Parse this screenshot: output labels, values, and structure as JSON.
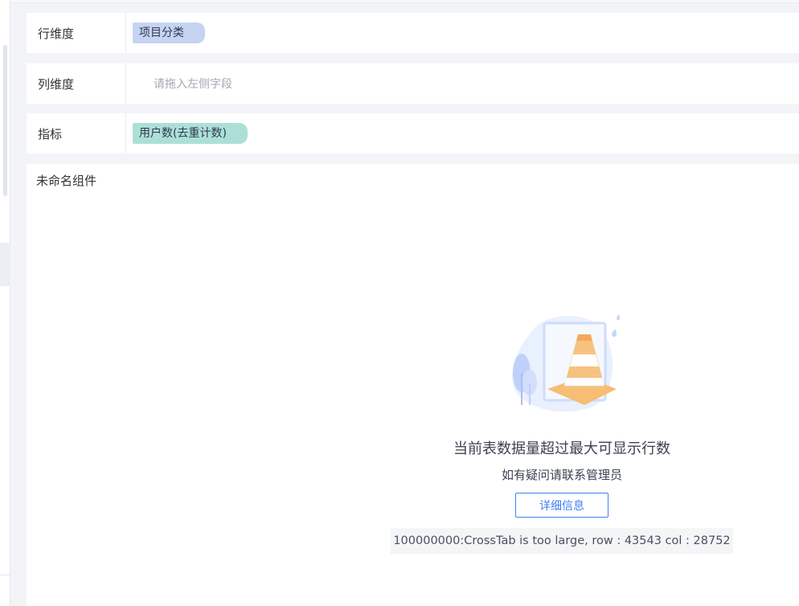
{
  "rows": [
    {
      "label": "行维度",
      "chip": "项目分类",
      "chip_color": "#c6d3f1"
    },
    {
      "label": "列维度",
      "placeholder": "请拖入左侧字段"
    },
    {
      "label": "指标",
      "chip": "用户数(去重计数)",
      "chip_color": "#ace0d6"
    }
  ],
  "panel": {
    "title": "未命名组件",
    "illustration": "traffic-cone-illustration",
    "message": "当前表数据量超过最大可显示行数",
    "sub_message": "如有疑问请联系管理员",
    "detail_button": "详细信息",
    "error_text": "100000000:CrossTab is too large, row : 43543 col : 28752"
  },
  "colors": {
    "accent": "#3f7ff5",
    "background": "#f3f4f7"
  }
}
